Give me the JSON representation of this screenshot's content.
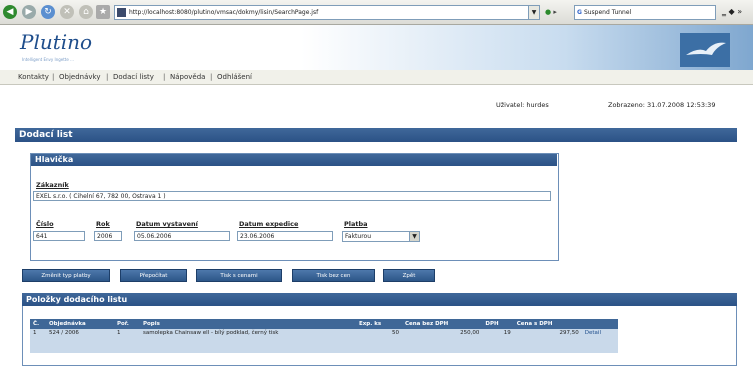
{
  "browser": {
    "url": "http://localhost:8080/plutino/vmsac/dokmy/lisin/SearchPage.jsf",
    "search_text": "Suspend Tunnel"
  },
  "app": {
    "logo": "Plutino",
    "logo_sub": "Intelligent Envy Ingette ..."
  },
  "nav": {
    "items": [
      "Kontakty",
      "Objednávky",
      "Dodací listy",
      "Nápověda",
      "Odhlášení"
    ]
  },
  "status": {
    "user": "Uživatel: hurdes",
    "stamp": "Zobrazeno: 31.07.2008 12:53:39"
  },
  "page": {
    "title": "Dodací list"
  },
  "header_section": {
    "title": "Hlavička",
    "customer_label": "Zákazník",
    "customer_value": "EXEL s.r.o. ( Cihelní 67, 782 00, Ostrava 1 )",
    "number_label": "Číslo",
    "number_value": "641",
    "year_label": "Rok",
    "year_value": "2006",
    "issue_date_label": "Datum vystavení",
    "issue_date_value": "05.06.2006",
    "ship_date_label": "Datum expedice",
    "ship_date_value": "23.06.2006",
    "payment_label": "Platba",
    "payment_value": "Fakturou"
  },
  "buttons": {
    "change_payment": "Změnit typ platby",
    "recalculate": "Přepočítat",
    "print_prices": "Tisk s cenami",
    "print_no_prices": "Tisk bez cen",
    "back": "Zpět"
  },
  "items_section": {
    "title": "Položky dodacího listu",
    "columns": [
      "Č.",
      "Objednávka",
      "Poř.",
      "Popis",
      "Exp. ks",
      "Cena bez DPH",
      "DPH",
      "Cena s DPH",
      ""
    ],
    "rows": [
      {
        "no": "1",
        "order": "524 / 2006",
        "pos": "1",
        "description": "samolepka Chainsaw ell - bílý podklad, černý tisk",
        "qty": "50",
        "price_net": "250,00",
        "vat": "19",
        "price_gross": "297,50",
        "detail": "Detail"
      }
    ]
  }
}
